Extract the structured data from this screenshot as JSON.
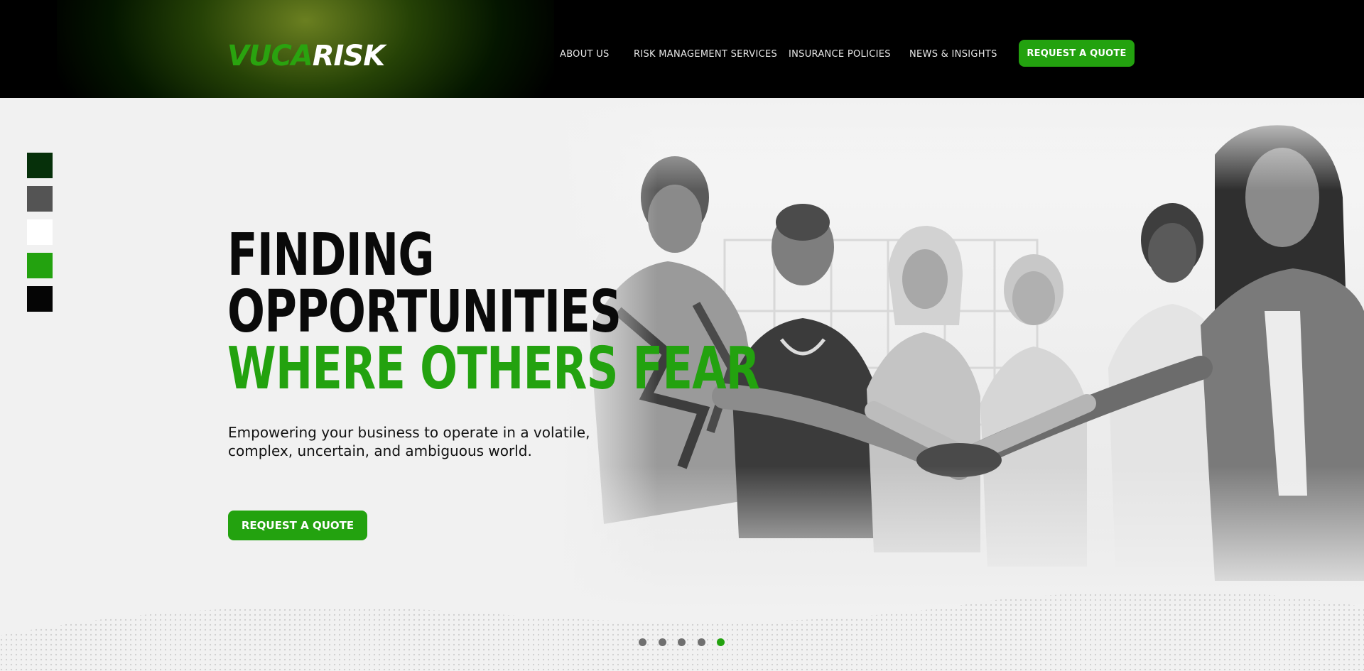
{
  "colors": {
    "header_bg": "#000000",
    "brand_green": "#23a20f",
    "hero_bg": "#f1f1f1",
    "text_dark": "#0a0a0a"
  },
  "header": {
    "logo": {
      "part1": "VUCA",
      "part2": "RISK"
    },
    "nav": [
      {
        "label": "ABOUT US"
      },
      {
        "label": "RISK MANAGEMENT SERVICES"
      },
      {
        "label": "INSURANCE POLICIES"
      },
      {
        "label": "NEWS & INSIGHTS"
      }
    ],
    "cta_label": "REQUEST A QUOTE"
  },
  "swatches": [
    "#06300a",
    "#545454",
    "#ffffff",
    "#23a20f",
    "#050505"
  ],
  "hero": {
    "headline_line1": "FINDING",
    "headline_line2": "OPPORTUNITIES",
    "headline_line3": "WHERE OTHERS FEAR",
    "subtext": "Empowering your business to operate in a volatile, complex, uncertain, and ambiguous world.",
    "cta_label": "REQUEST A QUOTE",
    "photo_alt": "group-of-women-stacking-hands-photo"
  },
  "pager": {
    "count": 5,
    "active_index": 4
  }
}
